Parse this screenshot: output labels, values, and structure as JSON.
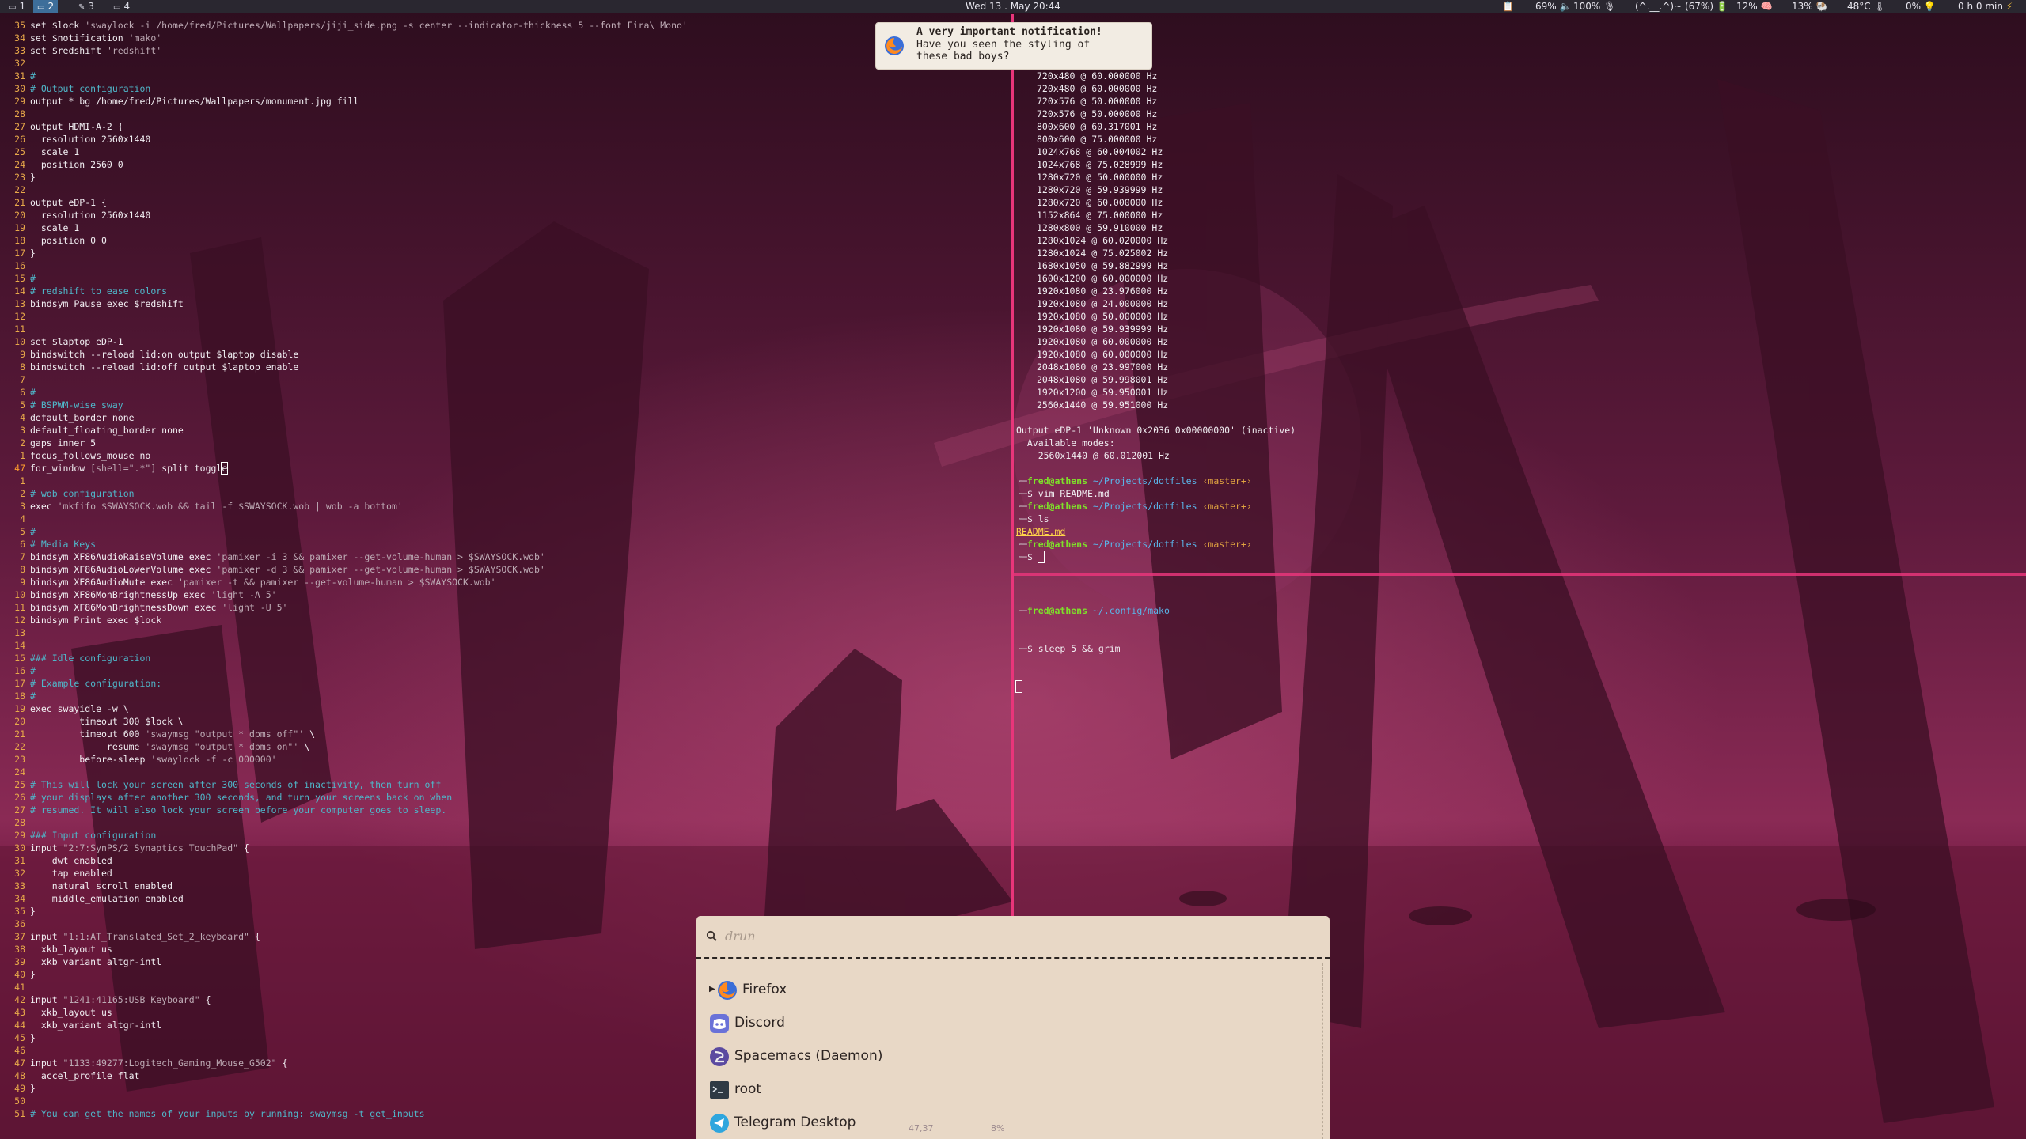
{
  "topbar": {
    "workspaces": [
      {
        "icon": "terminal-icon",
        "label": "1",
        "active": false
      },
      {
        "icon": "terminal-icon",
        "label": "2",
        "active": true
      },
      {
        "icon": "editor-icon",
        "label": "3",
        "active": false
      },
      {
        "icon": "window-icon",
        "label": "4",
        "active": false
      }
    ],
    "clock": "Wed 13 . May 20:44",
    "status": {
      "clipboard_icon": "clipboard-icon",
      "volume": "69%",
      "brightness": "100%",
      "mic_icon": "microphone-icon",
      "battery": "(^.__.^)~ (67%)",
      "cpu": "12%",
      "mem": "13%",
      "temp": "48°C",
      "idle": "0%",
      "uptime": "0 h 0 min"
    }
  },
  "editor": {
    "lines": [
      {
        "n": "35",
        "t": "set $lock ",
        "s": "'swaylock -i /home/fred/Pictures/Wallpapers/jiji_side.png -s center --indicator-thickness 5 --font Fira\\ Mono'"
      },
      {
        "n": "34",
        "t": "set $notification ",
        "s": "'mako'"
      },
      {
        "n": "33",
        "t": "set $redshift ",
        "s": "'redshift'"
      },
      {
        "n": "32",
        "t": ""
      },
      {
        "n": "31",
        "c": "#"
      },
      {
        "n": "30",
        "c": "# Output configuration"
      },
      {
        "n": "29",
        "t": "output * bg /home/fred/Pictures/Wallpapers/monument.jpg fill"
      },
      {
        "n": "28",
        "t": ""
      },
      {
        "n": "27",
        "t": "output HDMI-A-2 {"
      },
      {
        "n": "26",
        "t": "  resolution 2560x1440"
      },
      {
        "n": "25",
        "t": "  scale 1"
      },
      {
        "n": "24",
        "t": "  position 2560 0"
      },
      {
        "n": "23",
        "t": "}"
      },
      {
        "n": "22",
        "t": ""
      },
      {
        "n": "21",
        "t": "output eDP-1 {"
      },
      {
        "n": "20",
        "t": "  resolution 2560x1440"
      },
      {
        "n": "19",
        "t": "  scale 1"
      },
      {
        "n": "18",
        "t": "  position 0 0"
      },
      {
        "n": "17",
        "t": "}"
      },
      {
        "n": "16",
        "t": ""
      },
      {
        "n": "15",
        "c": "#"
      },
      {
        "n": "14",
        "c": "# redshift to ease colors"
      },
      {
        "n": "13",
        "t": "bindsym Pause exec $redshift"
      },
      {
        "n": "12",
        "t": ""
      },
      {
        "n": "11",
        "t": ""
      },
      {
        "n": "10",
        "t": "set $laptop eDP-1"
      },
      {
        "n": "9",
        "t": "bindswitch --reload lid:on output $laptop disable"
      },
      {
        "n": "8",
        "t": "bindswitch --reload lid:off output $laptop enable"
      },
      {
        "n": "7",
        "t": ""
      },
      {
        "n": "6",
        "c": "#"
      },
      {
        "n": "5",
        "c": "# BSPWM-wise sway"
      },
      {
        "n": "4",
        "t": "default_border none"
      },
      {
        "n": "3",
        "t": "default_floating_border none"
      },
      {
        "n": "2",
        "t": "gaps inner 5"
      },
      {
        "n": "1",
        "t": "focus_follows_mouse no"
      },
      {
        "n": "47",
        "t": "for_window ",
        "s": "[shell=\".*\"]",
        "t2": " split toggl",
        "cur": "e",
        "current": true
      },
      {
        "n": "1",
        "t": ""
      },
      {
        "n": "2",
        "c": "# wob configuration"
      },
      {
        "n": "3",
        "t": "exec ",
        "s": "'mkfifo $SWAYSOCK.wob && tail -f $SWAYSOCK.wob | wob -a bottom'"
      },
      {
        "n": "4",
        "t": ""
      },
      {
        "n": "5",
        "c": "#"
      },
      {
        "n": "6",
        "c": "# Media Keys"
      },
      {
        "n": "7",
        "t": "bindsym XF86AudioRaiseVolume exec ",
        "s": "'pamixer -i 3 && pamixer --get-volume-human > $SWAYSOCK.wob'"
      },
      {
        "n": "8",
        "t": "bindsym XF86AudioLowerVolume exec ",
        "s": "'pamixer -d 3 && pamixer --get-volume-human > $SWAYSOCK.wob'"
      },
      {
        "n": "9",
        "t": "bindsym XF86AudioMute exec ",
        "s": "'pamixer -t && pamixer --get-volume-human > $SWAYSOCK.wob'"
      },
      {
        "n": "10",
        "t": "bindsym XF86MonBrightnessUp exec ",
        "s": "'light -A 5'"
      },
      {
        "n": "11",
        "t": "bindsym XF86MonBrightnessDown exec ",
        "s": "'light -U 5'"
      },
      {
        "n": "12",
        "t": "bindsym Print exec $lock"
      },
      {
        "n": "13",
        "t": ""
      },
      {
        "n": "14",
        "t": ""
      },
      {
        "n": "15",
        "c": "### Idle configuration"
      },
      {
        "n": "16",
        "c": "#"
      },
      {
        "n": "17",
        "c": "# Example configuration:"
      },
      {
        "n": "18",
        "c": "#"
      },
      {
        "n": "19",
        "t": "exec swayidle -w \\"
      },
      {
        "n": "20",
        "t": "         timeout 300 $lock \\"
      },
      {
        "n": "21",
        "t": "         timeout 600 ",
        "s": "'swaymsg \"output * dpms off\"'",
        "t2": " \\"
      },
      {
        "n": "22",
        "t": "              resume ",
        "s": "'swaymsg \"output * dpms on\"'",
        "t2": " \\"
      },
      {
        "n": "23",
        "t": "         before-sleep ",
        "s": "'swaylock -f -c 000000'"
      },
      {
        "n": "24",
        "t": ""
      },
      {
        "n": "25",
        "c": "# This will lock your screen after 300 seconds of inactivity, then turn off"
      },
      {
        "n": "26",
        "c": "# your displays after another 300 seconds, and turn your screens back on when"
      },
      {
        "n": "27",
        "c": "# resumed. It will also lock your screen before your computer goes to sleep."
      },
      {
        "n": "28",
        "t": ""
      },
      {
        "n": "29",
        "c": "### Input configuration"
      },
      {
        "n": "30",
        "t": "input ",
        "s": "\"2:7:SynPS/2_Synaptics_TouchPad\"",
        "t2": " {"
      },
      {
        "n": "31",
        "t": "    dwt enabled"
      },
      {
        "n": "32",
        "t": "    tap enabled"
      },
      {
        "n": "33",
        "t": "    natural_scroll enabled"
      },
      {
        "n": "34",
        "t": "    middle_emulation enabled"
      },
      {
        "n": "35",
        "t": "}"
      },
      {
        "n": "36",
        "t": ""
      },
      {
        "n": "37",
        "t": "input ",
        "s": "\"1:1:AT_Translated_Set_2_keyboard\"",
        "t2": " {"
      },
      {
        "n": "38",
        "t": "  xkb_layout us"
      },
      {
        "n": "39",
        "t": "  xkb_variant altgr-intl"
      },
      {
        "n": "40",
        "t": "}"
      },
      {
        "n": "41",
        "t": ""
      },
      {
        "n": "42",
        "t": "input ",
        "s": "\"1241:41165:USB_Keyboard\"",
        "t2": " {"
      },
      {
        "n": "43",
        "t": "  xkb_layout us"
      },
      {
        "n": "44",
        "t": "  xkb_variant altgr-intl"
      },
      {
        "n": "45",
        "t": "}"
      },
      {
        "n": "46",
        "t": ""
      },
      {
        "n": "47",
        "t": "input ",
        "s": "\"1133:49277:Logitech_Gaming_Mouse_G502\"",
        "t2": " {"
      },
      {
        "n": "48",
        "t": "  accel_profile flat"
      },
      {
        "n": "49",
        "t": "}"
      },
      {
        "n": "50",
        "t": ""
      },
      {
        "n": "51",
        "c": "# You can get the names of your inputs by running: swaymsg -t get_inputs"
      }
    ]
  },
  "terminal_top": {
    "modes": [
      "720x480 @ 60.000000 Hz",
      "720x480 @ 60.000000 Hz",
      "720x576 @ 50.000000 Hz",
      "720x576 @ 50.000000 Hz",
      "800x600 @ 60.317001 Hz",
      "800x600 @ 75.000000 Hz",
      "1024x768 @ 60.004002 Hz",
      "1024x768 @ 75.028999 Hz",
      "1280x720 @ 50.000000 Hz",
      "1280x720 @ 59.939999 Hz",
      "1280x720 @ 60.000000 Hz",
      "1152x864 @ 75.000000 Hz",
      "1280x800 @ 59.910000 Hz",
      "1280x1024 @ 60.020000 Hz",
      "1280x1024 @ 75.025002 Hz",
      "1680x1050 @ 59.882999 Hz",
      "1600x1200 @ 60.000000 Hz",
      "1920x1080 @ 23.976000 Hz",
      "1920x1080 @ 24.000000 Hz",
      "1920x1080 @ 50.000000 Hz",
      "1920x1080 @ 59.939999 Hz",
      "1920x1080 @ 60.000000 Hz",
      "1920x1080 @ 60.000000 Hz",
      "2048x1080 @ 23.997000 Hz",
      "2048x1080 @ 59.998001 Hz",
      "1920x1200 @ 59.950001 Hz",
      "2560x1440 @ 59.951000 Hz"
    ],
    "output_line": "Output eDP-1 'Unknown 0x2036 0x00000000' (inactive)",
    "available": "  Available modes:",
    "edp_mode": "    2560x1440 @ 60.012001 Hz",
    "prompts": [
      {
        "user": "fred@athens",
        "path": "~/Projects/dotfiles",
        "branch": "‹master+›",
        "cmd": "vim README.md"
      },
      {
        "user": "fred@athens",
        "path": "~/Projects/dotfiles",
        "branch": "‹master+›",
        "cmd": "ls"
      },
      {
        "user": "fred@athens",
        "path": "~/Projects/dotfiles",
        "branch": "‹master+›",
        "cmd": ""
      }
    ],
    "ls_output": "README.md",
    "dollar": "$"
  },
  "terminal_bottom": {
    "user": "fred@athens",
    "path": "~/.config/mako",
    "cmd": "sleep 5 && grim",
    "dollar": "$"
  },
  "notification": {
    "title": "A very important notification!",
    "body_l1": "Have you seen the styling of",
    "body_l2": "these bad boys?",
    "icon": "firefox-icon"
  },
  "launcher": {
    "placeholder": "drun",
    "items": [
      {
        "label": "Firefox",
        "icon": "firefox-icon",
        "expandable": true
      },
      {
        "label": "Discord",
        "icon": "discord-icon"
      },
      {
        "label": "Spacemacs (Daemon)",
        "icon": "spacemacs-icon"
      },
      {
        "label": "root",
        "icon": "terminal-icon"
      },
      {
        "label": "Telegram Desktop",
        "icon": "telegram-icon"
      }
    ]
  },
  "statusline": {
    "pos": "47,37",
    "pct": "8%"
  },
  "colors": {
    "accent": "#e8357a",
    "wallpaper_dark": "#3a1024",
    "wallpaper_mid": "#6a1c40",
    "comment": "#4fb6c9",
    "string": "#bdaab4",
    "linenr": "#e8a94a",
    "prompt_user": "#7ee02a",
    "prompt_path": "#5ab4e8",
    "prompt_branch": "#e0a340",
    "launcher_bg": "#e8d8c6",
    "notif_bg": "#f2ece3"
  }
}
